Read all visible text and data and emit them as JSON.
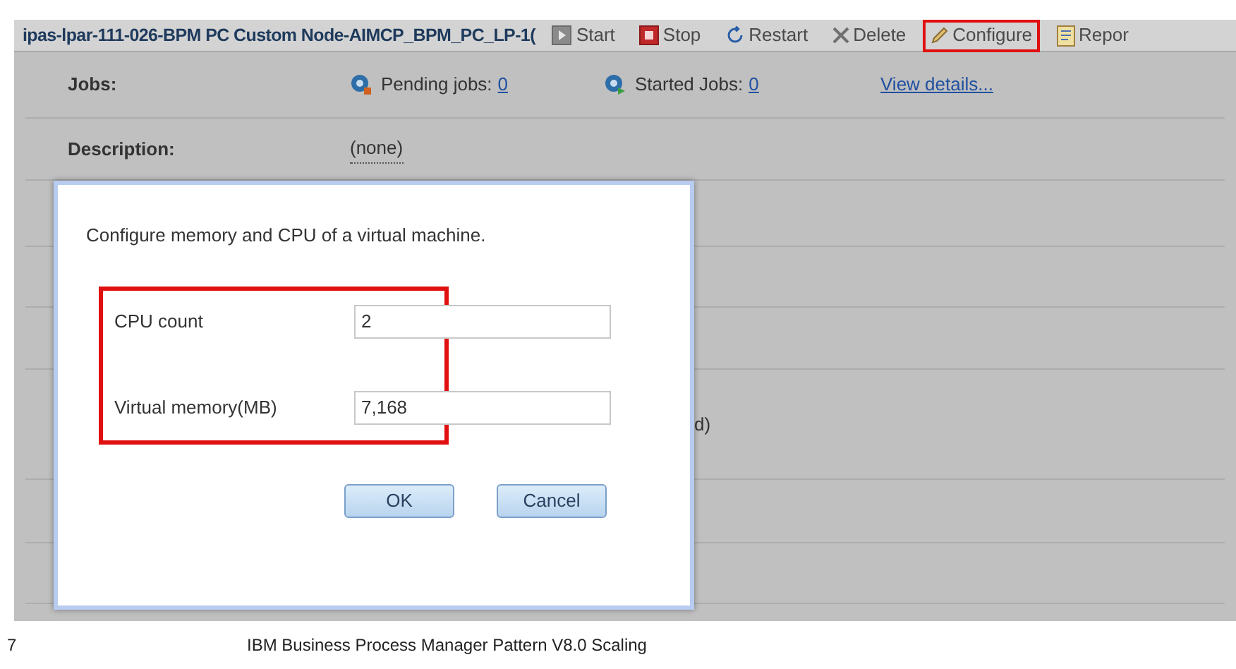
{
  "header": {
    "title": "ipas-lpar-111-026-BPM PC Custom Node-AIMCP_BPM_PC_LP-1(",
    "actions": [
      {
        "label": "Start",
        "kind": "start",
        "highlighted": false
      },
      {
        "label": "Stop",
        "kind": "stop",
        "highlighted": false
      },
      {
        "label": "Restart",
        "kind": "restart",
        "highlighted": false
      },
      {
        "label": "Delete",
        "kind": "delete",
        "highlighted": false
      },
      {
        "label": "Configure",
        "kind": "configure",
        "highlighted": true
      },
      {
        "label": "Repor",
        "kind": "report",
        "highlighted": false
      }
    ]
  },
  "details": {
    "jobs": {
      "label": "Jobs:",
      "pending_label": "Pending jobs:",
      "pending_count": "0",
      "started_label": "Started Jobs:",
      "started_count": "0",
      "link": "View details..."
    },
    "description": {
      "label": "Description:",
      "value": "(none)"
    },
    "covered_text": "d)"
  },
  "dialog": {
    "message": "Configure memory and CPU of a virtual machine.",
    "fields_highlighted": true,
    "fields": [
      {
        "label": "CPU count",
        "value": "2"
      },
      {
        "label": "Virtual memory(MB)",
        "value": "7,168"
      }
    ],
    "buttons": [
      "OK",
      "Cancel"
    ]
  },
  "footer": {
    "page_number": "7",
    "title": "IBM  Business Process Manager Pattern  V8.0 Scaling"
  }
}
